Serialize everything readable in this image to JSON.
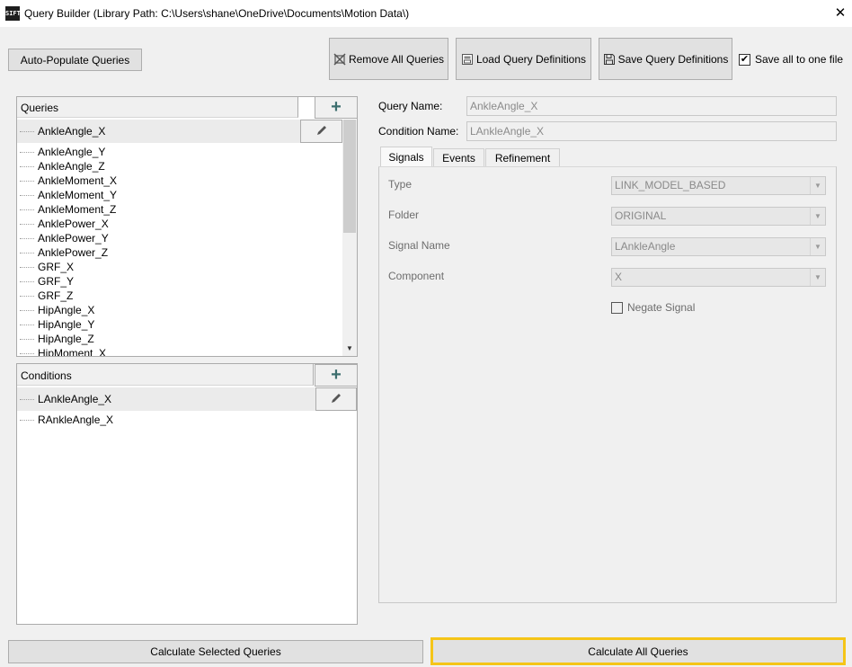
{
  "window": {
    "icon_text": "SIFT",
    "title": "Query Builder (Library Path: C:\\Users\\shane\\OneDrive\\Documents\\Motion Data\\)",
    "close_glyph": "✕"
  },
  "toolbar": {
    "auto_populate": "Auto-Populate Queries",
    "remove_all": "Remove All Queries",
    "load_defs": "Load Query Definitions",
    "save_defs": "Save Query Definitions",
    "save_all_label": "Save all to one file",
    "save_all_checked": true
  },
  "queries": {
    "header": "Queries",
    "selected": "AnkleAngle_X",
    "items": [
      "AnkleAngle_Y",
      "AnkleAngle_Z",
      "AnkleMoment_X",
      "AnkleMoment_Y",
      "AnkleMoment_Z",
      "AnklePower_X",
      "AnklePower_Y",
      "AnklePower_Z",
      "GRF_X",
      "GRF_Y",
      "GRF_Z",
      "HipAngle_X",
      "HipAngle_Y",
      "HipAngle_Z",
      "HipMoment_X"
    ]
  },
  "conditions": {
    "header": "Conditions",
    "selected": "LAnkleAngle_X",
    "items": [
      "RAnkleAngle_X"
    ]
  },
  "details": {
    "query_name_label": "Query Name:",
    "query_name_value": "AnkleAngle_X",
    "condition_name_label": "Condition Name:",
    "condition_name_value": "LAnkleAngle_X",
    "tabs": [
      "Signals",
      "Events",
      "Refinement"
    ],
    "active_tab": "Signals",
    "signals": {
      "type_label": "Type",
      "type_value": "LINK_MODEL_BASED",
      "folder_label": "Folder",
      "folder_value": "ORIGINAL",
      "signal_name_label": "Signal Name",
      "signal_name_value": "LAnkleAngle",
      "component_label": "Component",
      "component_value": "X",
      "negate_label": "Negate Signal",
      "negate_checked": false
    }
  },
  "footer": {
    "calc_selected": "Calculate Selected Queries",
    "calc_all": "Calculate All Queries"
  },
  "colors": {
    "highlight_border": "#f5c518",
    "plus_color": "#3c6e6e"
  }
}
